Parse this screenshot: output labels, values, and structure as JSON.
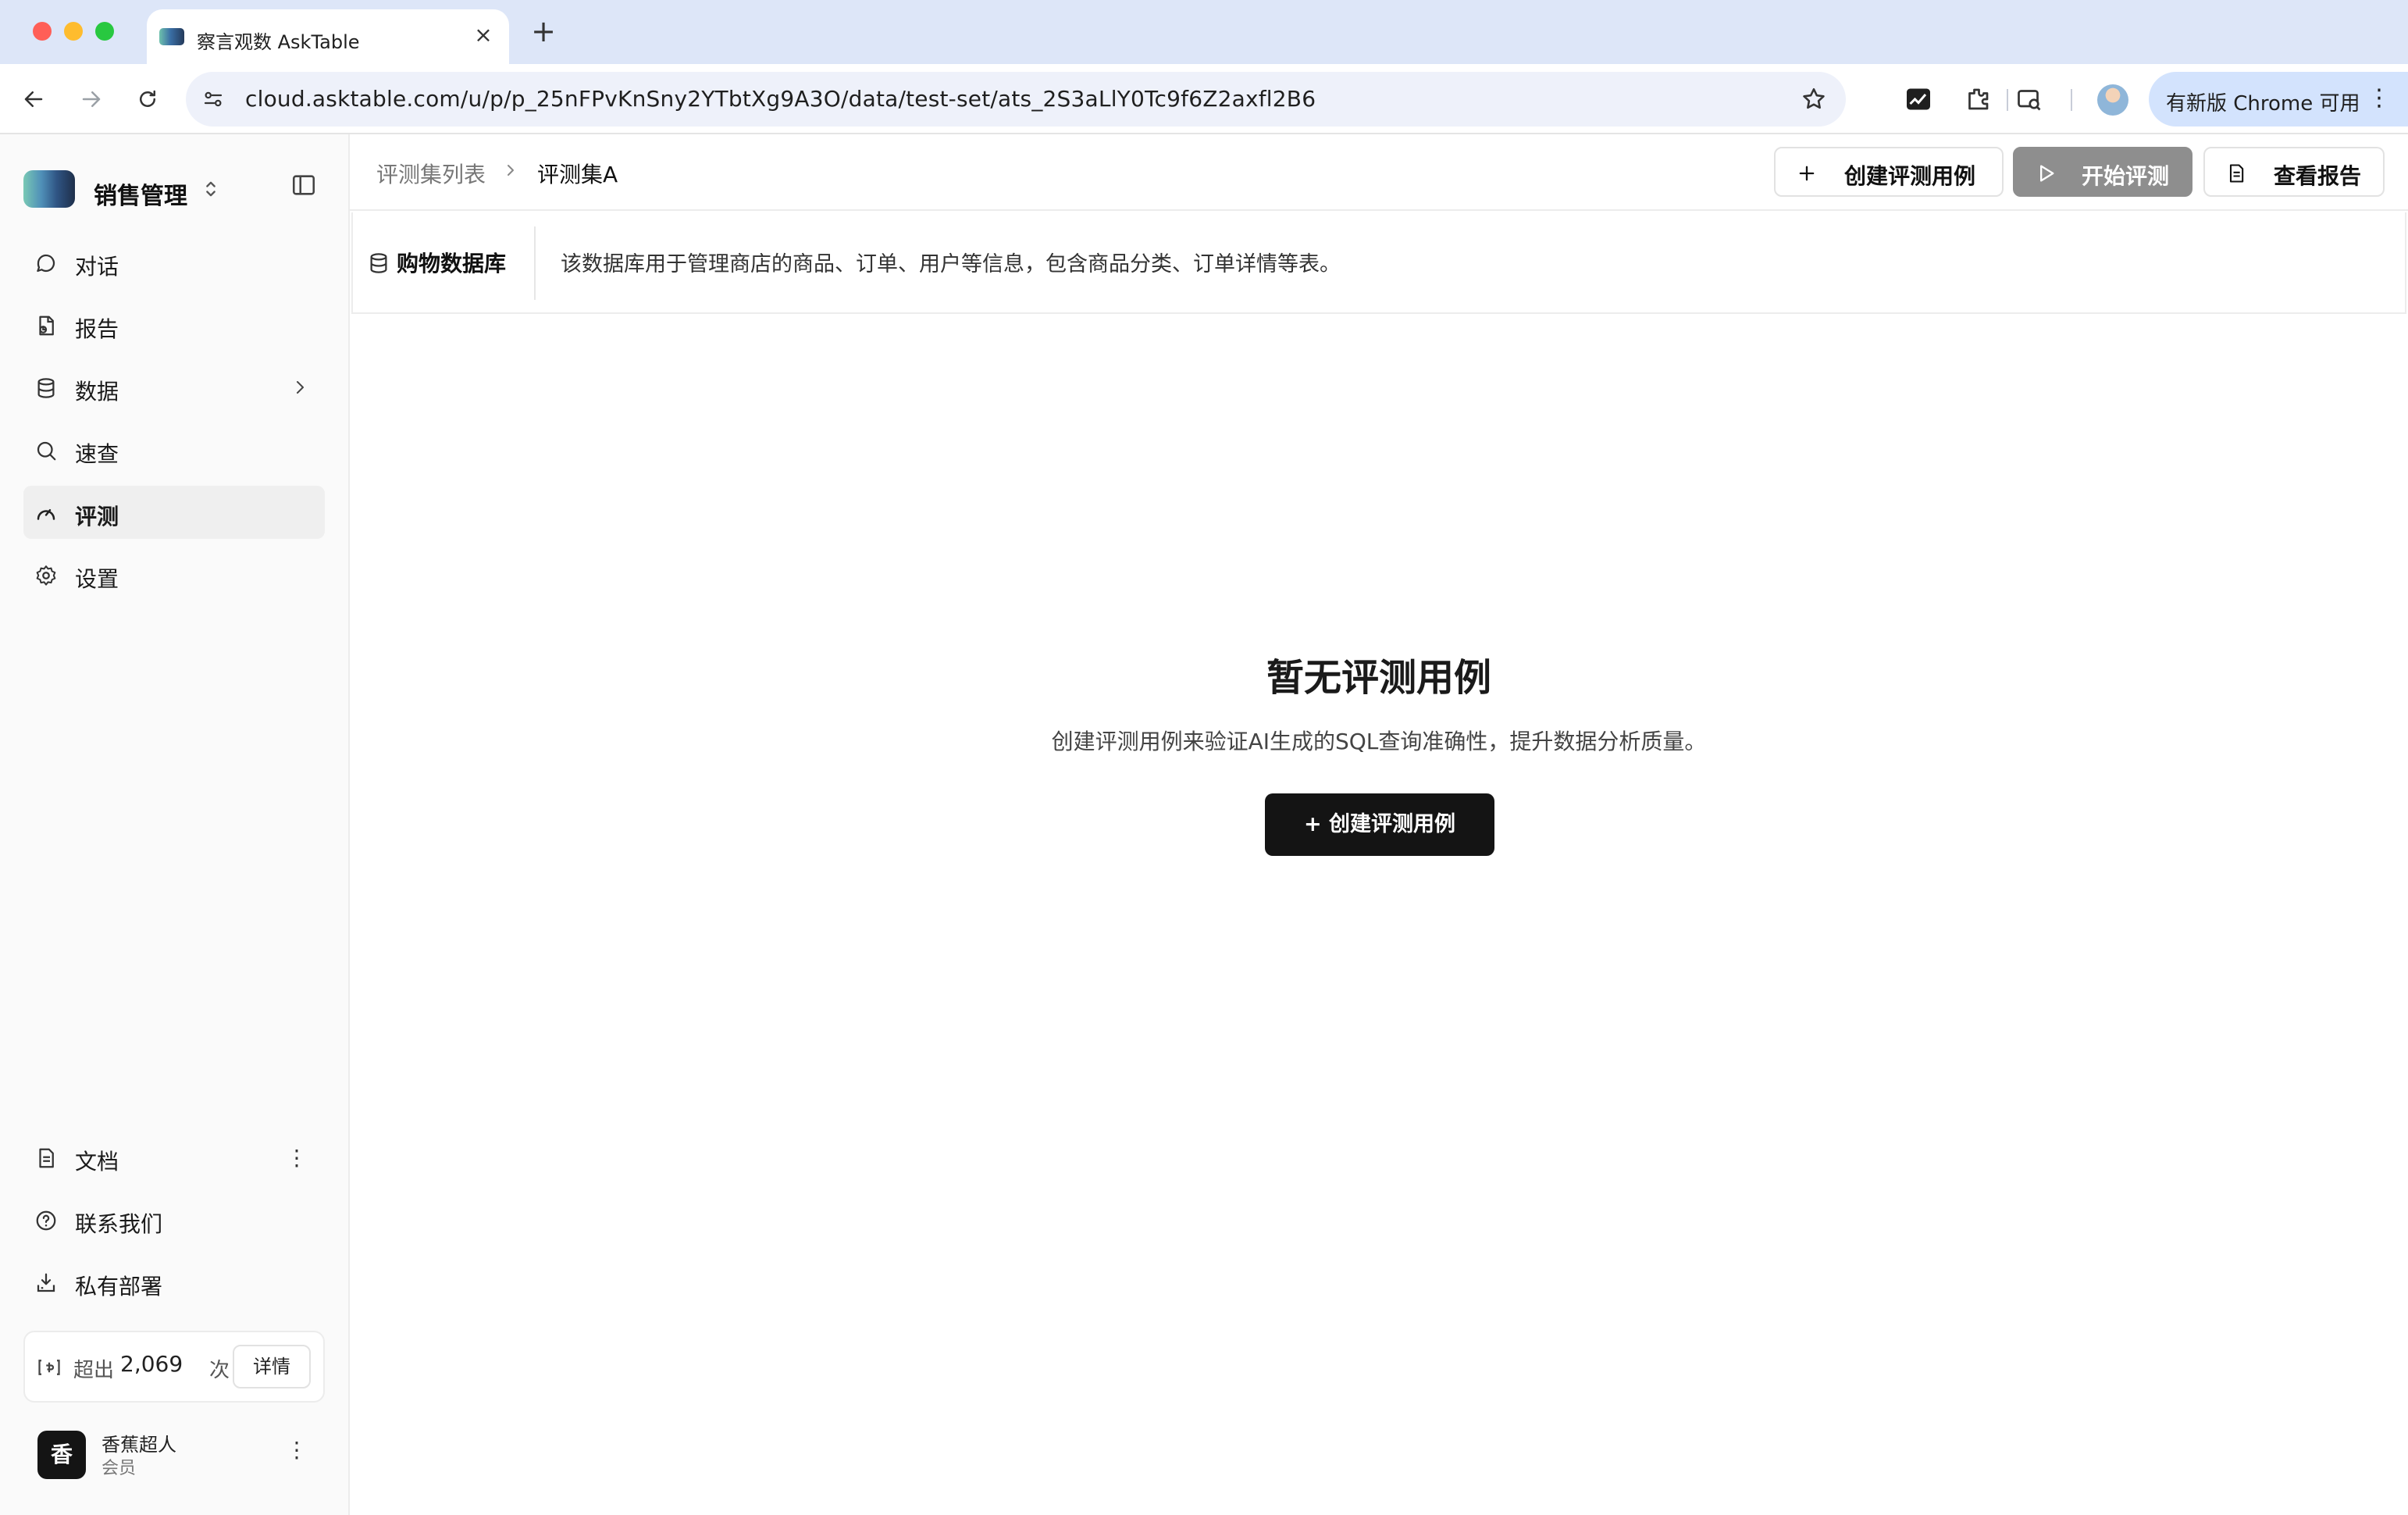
{
  "browser": {
    "tab_title": "察言观数 AskTable",
    "url": "cloud.asktable.com/u/p/p_25nFPvKnSny2YTbtXg9A3O/data/test-set/ats_2S3aLlY0Tc9f6Z2axfl2B6",
    "update_label": "有新版 Chrome 可用"
  },
  "sidebar": {
    "workspace_name": "销售管理",
    "nav": [
      {
        "label": "对话",
        "icon": "chat-bubble-icon"
      },
      {
        "label": "报告",
        "icon": "report-icon"
      },
      {
        "label": "数据",
        "icon": "database-icon"
      },
      {
        "label": "速查",
        "icon": "search-icon"
      },
      {
        "label": "评测",
        "icon": "gauge-icon",
        "active": true
      },
      {
        "label": "设置",
        "icon": "gear-icon"
      }
    ],
    "bottom_nav": [
      {
        "label": "文档",
        "icon": "document-icon"
      },
      {
        "label": "联系我们",
        "icon": "help-circle-icon"
      },
      {
        "label": "私有部署",
        "icon": "download-tray-icon"
      }
    ],
    "quota": {
      "label": "超出",
      "value": "2,069",
      "unit": "次",
      "button": "详情"
    },
    "user": {
      "avatar_char": "香",
      "name": "香蕉超人",
      "role": "会员"
    }
  },
  "main": {
    "breadcrumb": {
      "parent": "评测集列表",
      "current": "评测集A"
    },
    "actions": {
      "create": "创建评测用例",
      "start": "开始评测",
      "report": "查看报告"
    },
    "datasource": {
      "name": "购物数据库",
      "description": "该数据库用于管理商店的商品、订单、用户等信息，包含商品分类、订单详情等表。"
    },
    "empty_state": {
      "title": "暂无评测用例",
      "description": "创建评测用例来验证AI生成的SQL查询准确性，提升数据分析质量。",
      "button": "+ 创建评测用例"
    }
  },
  "colors": {
    "tabstrip_bg": "#dde6f8",
    "sidebar_bg": "#fafafa",
    "primary_dark": "#141414",
    "disabled_gray": "#8e8e8e"
  }
}
